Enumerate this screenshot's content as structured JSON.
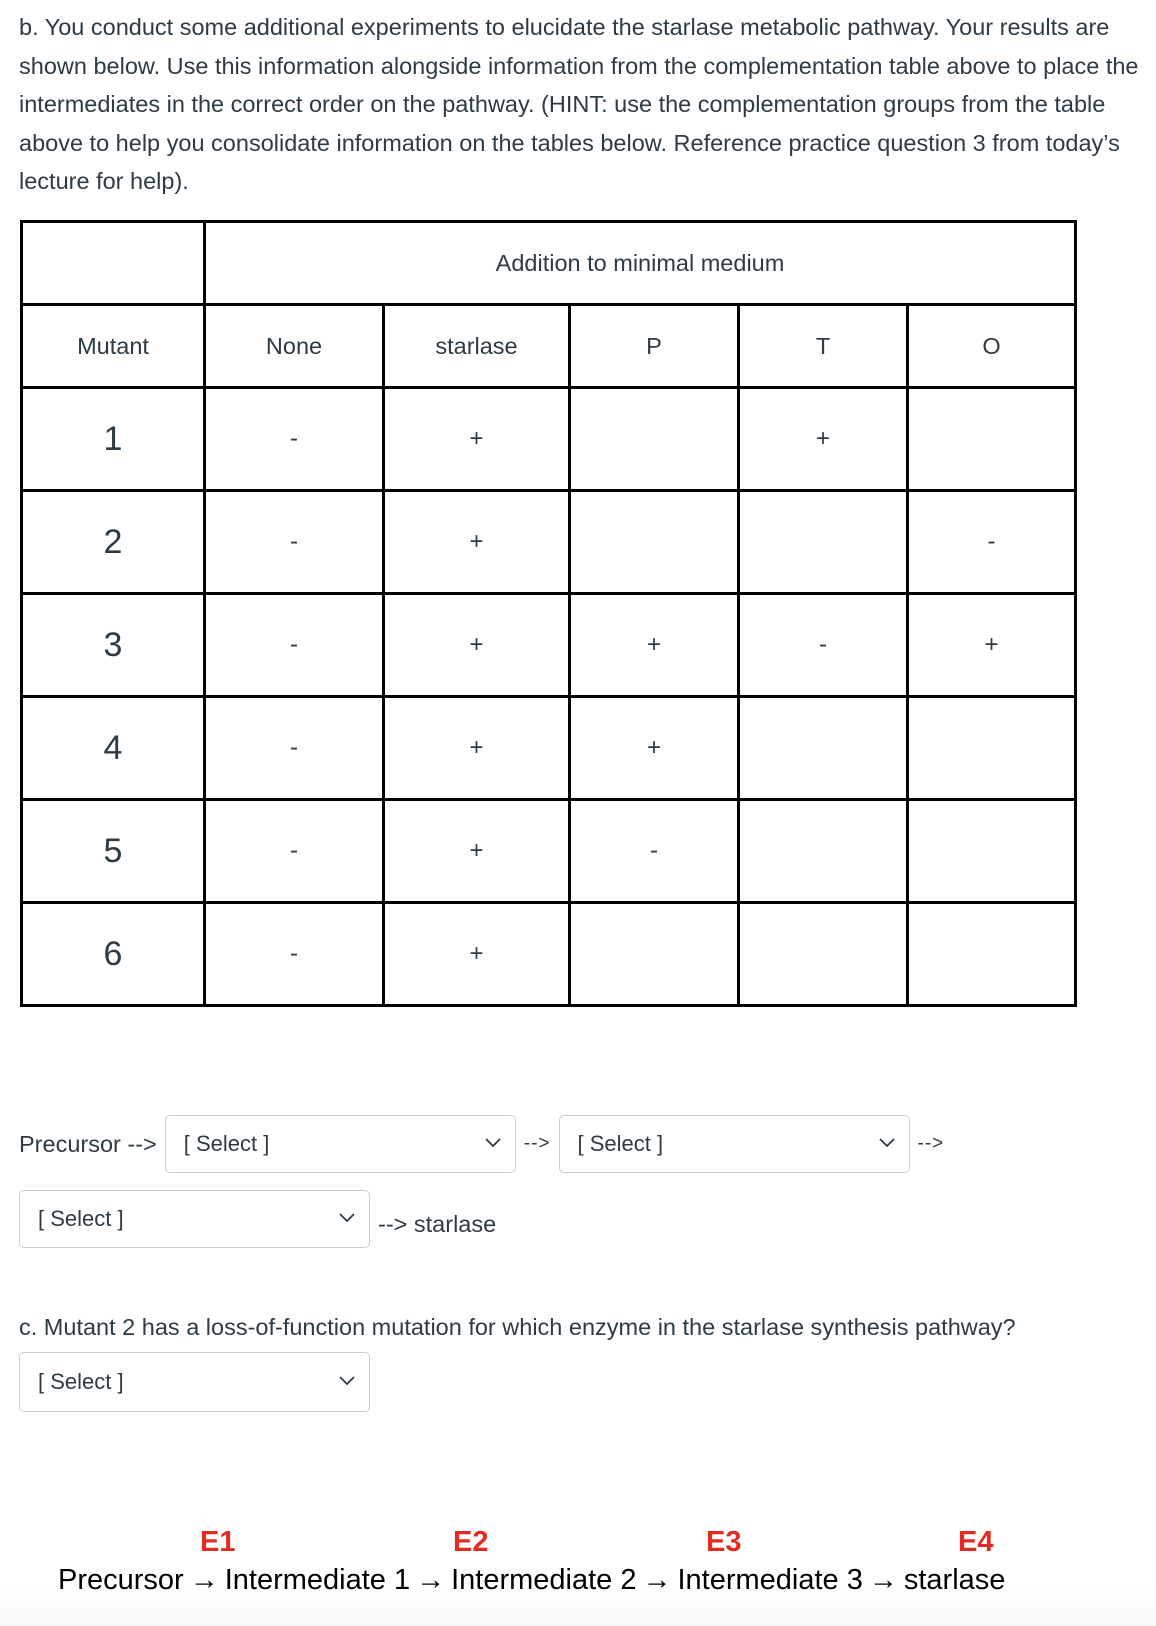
{
  "question_b": {
    "text": "b. You conduct some additional experiments to elucidate the starlase metabolic pathway. Your results are shown below. Use this information alongside information from the complementation table above to place the intermediates in the correct order on the pathway. (HINT: use the complementation groups from the table above to help you consolidate information on the tables below. Reference practice question 3 from today’s lecture for help)."
  },
  "table": {
    "group_header": "Addition to minimal medium",
    "columns": [
      "Mutant",
      "None",
      "starlase",
      "P",
      "T",
      "O"
    ],
    "rows": [
      {
        "mutant": "1",
        "none": "-",
        "starlase": "+",
        "P": "",
        "T": "+",
        "O": ""
      },
      {
        "mutant": "2",
        "none": "-",
        "starlase": "+",
        "P": "",
        "T": "",
        "O": "-"
      },
      {
        "mutant": "3",
        "none": "-",
        "starlase": "+",
        "P": "+",
        "T": "-",
        "O": "+"
      },
      {
        "mutant": "4",
        "none": "-",
        "starlase": "+",
        "P": "+",
        "T": "",
        "O": ""
      },
      {
        "mutant": "5",
        "none": "-",
        "starlase": "+",
        "P": "-",
        "T": "",
        "O": ""
      },
      {
        "mutant": "6",
        "none": "-",
        "starlase": "+",
        "P": "",
        "T": "",
        "O": ""
      }
    ]
  },
  "pathway_answer": {
    "start_label": "Precursor -->",
    "arrow": "-->",
    "end_label": "--> starlase",
    "selects": [
      {
        "value": "[ Select ]"
      },
      {
        "value": "[ Select ]"
      },
      {
        "value": "[ Select ]"
      }
    ]
  },
  "question_c": {
    "text": "c. Mutant 2 has a loss-of-function mutation for which enzyme in the starlase synthesis pathway?",
    "select_value": "[ Select ]"
  },
  "pathway_figure": {
    "enzymes": [
      "E1",
      "E2",
      "E3",
      "E4"
    ],
    "steps": [
      "Precursor",
      "Intermediate 1",
      "Intermediate 2",
      "Intermediate 3",
      "starlase"
    ],
    "arrow_glyph": "→",
    "enzyme_color": "#e32b22"
  }
}
